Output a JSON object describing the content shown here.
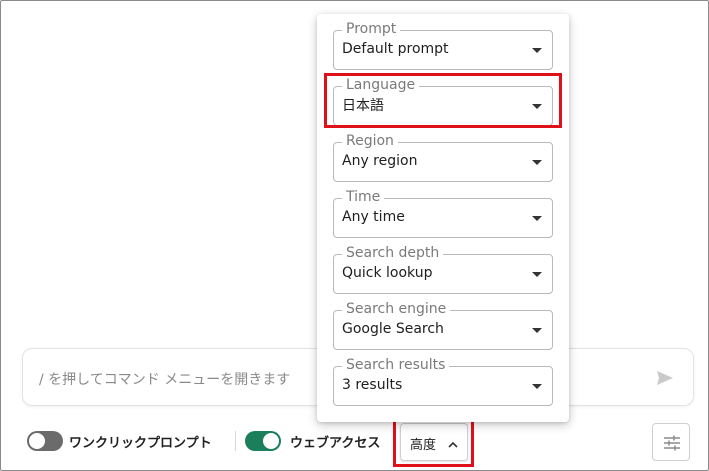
{
  "chat": {
    "placeholder": "/ を押してコマンド メニューを開きます"
  },
  "toolbar": {
    "one_click_prompt_label": "ワンクリックプロンプト",
    "one_click_prompt_on": false,
    "web_access_label": "ウェブアクセス",
    "web_access_on": true,
    "advanced_label": "高度"
  },
  "options": [
    {
      "label": "Prompt",
      "value": "Default prompt"
    },
    {
      "label": "Language",
      "value": "日本語"
    },
    {
      "label": "Region",
      "value": "Any region"
    },
    {
      "label": "Time",
      "value": "Any time"
    },
    {
      "label": "Search depth",
      "value": "Quick lookup"
    },
    {
      "label": "Search engine",
      "value": "Google Search"
    },
    {
      "label": "Search results",
      "value": "3 results"
    }
  ],
  "colors": {
    "highlight": "#e0101a",
    "toggle_on": "#1a7f5a",
    "toggle_off": "#6b6b6b"
  },
  "icons": {
    "send": "send-icon",
    "chevron": "chevron-up-icon",
    "settings": "sliders-icon"
  }
}
